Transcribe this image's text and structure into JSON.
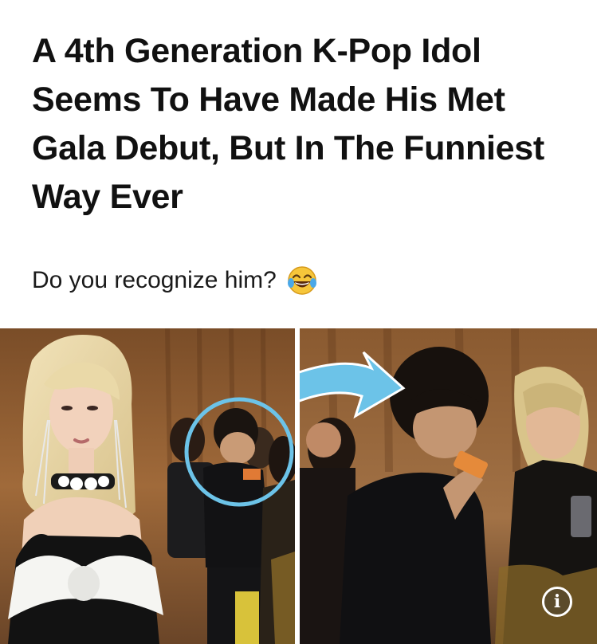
{
  "article": {
    "headline": "A 4th Generation K-Pop Idol Seems To Have Made His Met Gala Debut, But In The Funniest Way Ever",
    "subheadline": "Do you recognize him?",
    "subheadline_emoji": "face-with-tears-of-joy-emoji"
  },
  "media": {
    "left_photo": "rose-met-gala-photo",
    "right_photo": "zoomed-idol-photo",
    "annotation_circle_color": "#6cc3e8",
    "annotation_arrow_color": "#6cc3e8",
    "info_icon": "info-icon",
    "info_glyph": "i"
  }
}
